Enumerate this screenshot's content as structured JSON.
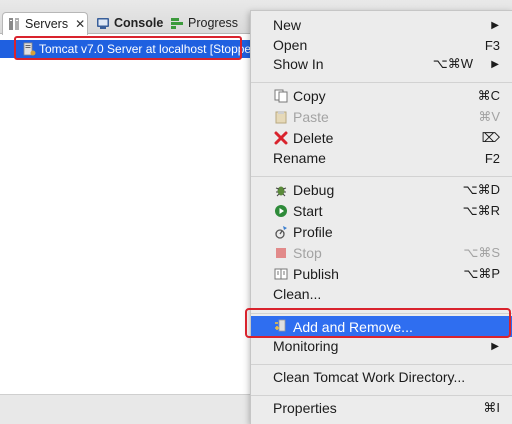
{
  "tabs": [
    {
      "label": "Servers",
      "icon": "servers-icon",
      "close": "✕"
    },
    {
      "label": "Console",
      "icon": "console-icon"
    },
    {
      "label": "Progress",
      "icon": "progress-icon"
    }
  ],
  "server_row": {
    "label": "Tomcat v7.0 Server at localhost  [Stoppe",
    "icon": "tomcat-server-icon"
  },
  "menu": {
    "new": {
      "label": "New",
      "submenu": "▶"
    },
    "open": {
      "label": "Open",
      "shortcut": "F3"
    },
    "show_in": {
      "label": "Show In",
      "shortcut": "⌥⌘W",
      "submenu": "▶"
    },
    "copy": {
      "label": "Copy",
      "shortcut": "⌘C",
      "icon": "copy-icon"
    },
    "paste": {
      "label": "Paste",
      "shortcut": "⌘V",
      "icon": "paste-icon"
    },
    "delete": {
      "label": "Delete",
      "shortcut": "⌦",
      "icon": "delete-icon"
    },
    "rename": {
      "label": "Rename",
      "shortcut": "F2"
    },
    "debug": {
      "label": "Debug",
      "shortcut": "⌥⌘D",
      "icon": "debug-icon"
    },
    "start": {
      "label": "Start",
      "shortcut": "⌥⌘R",
      "icon": "start-icon"
    },
    "profile": {
      "label": "Profile",
      "icon": "profile-icon"
    },
    "stop": {
      "label": "Stop",
      "shortcut": "⌥⌘S",
      "icon": "stop-icon"
    },
    "publish": {
      "label": "Publish",
      "shortcut": "⌥⌘P",
      "icon": "publish-icon"
    },
    "clean": {
      "label": "Clean..."
    },
    "add_remove": {
      "label": "Add and Remove...",
      "icon": "add-remove-icon"
    },
    "monitoring": {
      "label": "Monitoring",
      "submenu": "▶"
    },
    "clean_tomcat": {
      "label": "Clean Tomcat Work Directory..."
    },
    "properties": {
      "label": "Properties",
      "shortcut": "⌘I"
    }
  },
  "colors": {
    "selection": "#2f6ef0",
    "highlight": "#d9232d",
    "row_selection": "#1f60e0"
  }
}
